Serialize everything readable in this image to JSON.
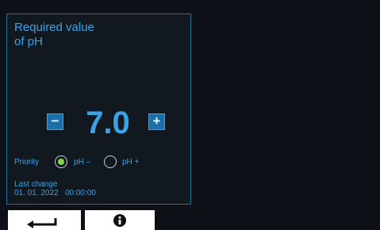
{
  "panel": {
    "title_line1": "Required value",
    "title_line2": "of pH"
  },
  "setpoint": {
    "value": "7.0",
    "minus_label": "−",
    "plus_label": "+"
  },
  "priority": {
    "label": "Priority",
    "options": [
      {
        "label": "pH –",
        "selected": true
      },
      {
        "label": "pH +",
        "selected": false
      }
    ]
  },
  "last_change": {
    "label": "Last change",
    "value": "01. 01. 2022   00:00:00"
  },
  "footer": {
    "back_icon": "return-arrow-icon",
    "info_icon": "info-icon"
  },
  "colors": {
    "accent": "#3aa3e6",
    "selected": "#7fd44a",
    "background": "#0d1117"
  }
}
